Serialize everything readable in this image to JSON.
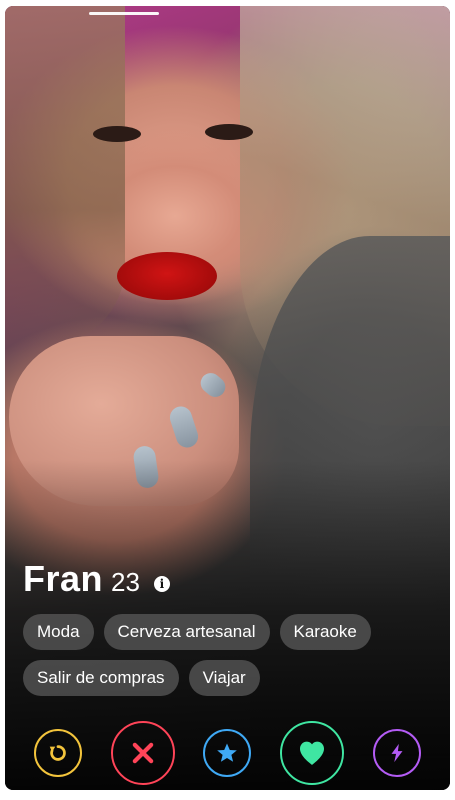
{
  "profile": {
    "name": "Fran",
    "age": "23",
    "info_icon": "info-icon"
  },
  "interests": [
    "Moda",
    "Cerveza artesanal",
    "Karaoke",
    "Salir de compras",
    "Viajar"
  ],
  "actions": [
    {
      "name": "rewind",
      "icon": "rewind-icon",
      "color": "#f3c43c"
    },
    {
      "name": "nope",
      "icon": "x-icon",
      "color": "#ff4458"
    },
    {
      "name": "super-like",
      "icon": "star-icon",
      "color": "#3fa9f5"
    },
    {
      "name": "like",
      "icon": "heart-icon",
      "color": "#3fe6a2"
    },
    {
      "name": "boost",
      "icon": "bolt-icon",
      "color": "#b45cf5"
    }
  ],
  "photo": {
    "index": 1
  }
}
